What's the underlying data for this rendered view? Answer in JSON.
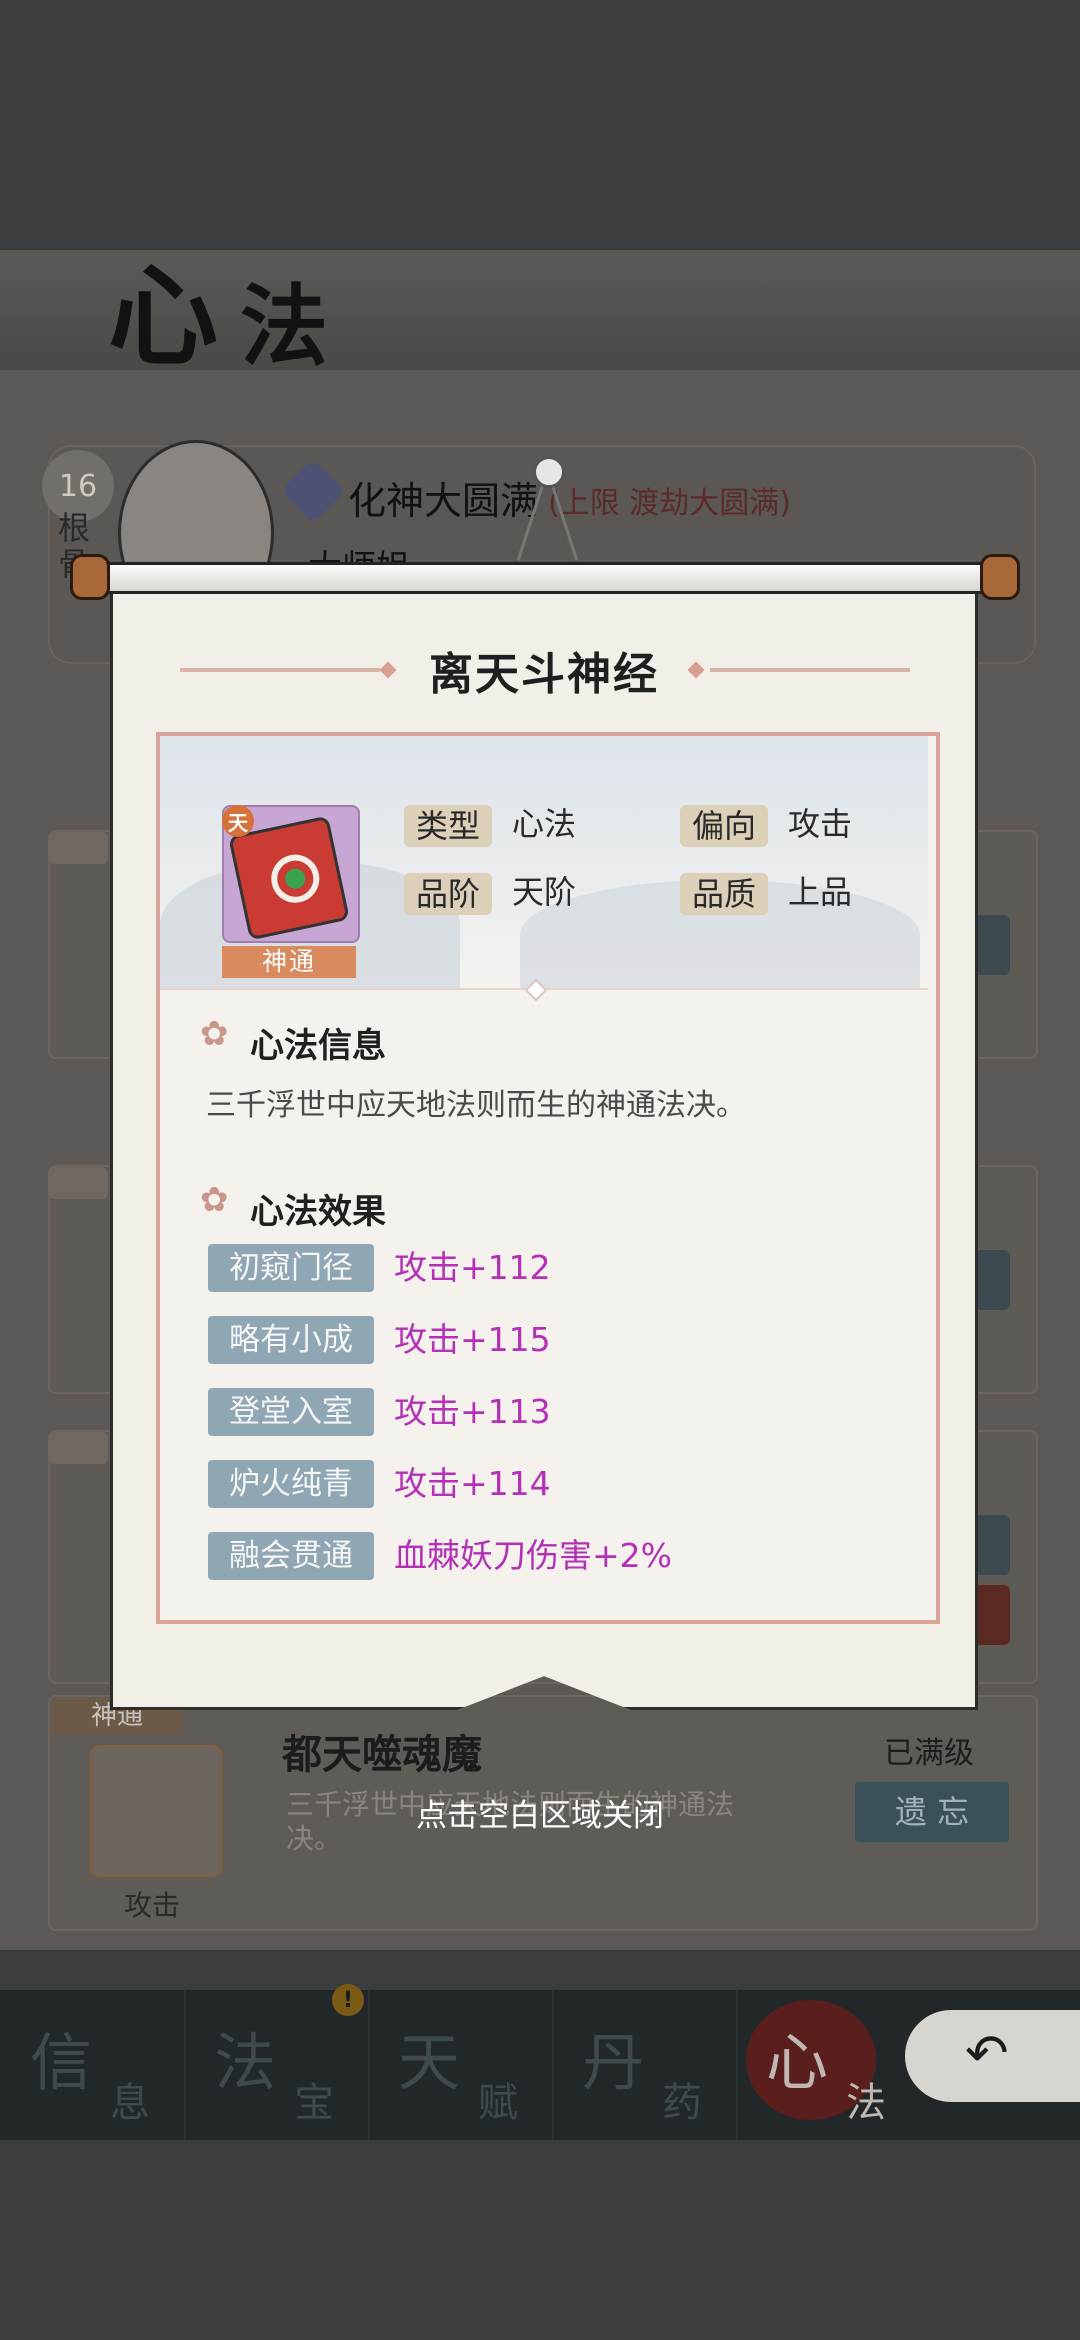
{
  "page": {
    "title_chars": [
      "心",
      "法"
    ]
  },
  "character": {
    "level": "16",
    "root_label": "根骨",
    "realm": "化神大圆满",
    "realm_limit": "(上限 渡劫大圆满)",
    "name": "大师姐"
  },
  "background_card": {
    "tag": "神通",
    "name": "都天噬魂魔",
    "desc": "三千浮世中应天地法则而生的神通法决。",
    "icon_label": "攻击",
    "status": "已满级",
    "action": "遗 忘"
  },
  "bottom_nav": {
    "items": [
      {
        "big": "信",
        "small": "息"
      },
      {
        "big": "法",
        "small": "宝"
      },
      {
        "big": "天",
        "small": "赋"
      },
      {
        "big": "丹",
        "small": "药"
      },
      {
        "big": "心",
        "small": "法"
      }
    ],
    "badge": "!",
    "active_index": 4
  },
  "popup": {
    "title": "离天斗神经",
    "book_badge": "天",
    "book_tag": "神通",
    "attributes": [
      {
        "key": "类型",
        "value": "心法"
      },
      {
        "key": "偏向",
        "value": "攻击"
      },
      {
        "key": "品阶",
        "value": "天阶"
      },
      {
        "key": "品质",
        "value": "上品"
      }
    ],
    "info_section": {
      "title": "心法信息",
      "text": "三千浮世中应天地法则而生的神通法决。"
    },
    "effect_section": {
      "title": "心法效果",
      "stages": [
        {
          "name": "初窥门径",
          "effect": "攻击+112"
        },
        {
          "name": "略有小成",
          "effect": "攻击+115"
        },
        {
          "name": "登堂入室",
          "effect": "攻击+113"
        },
        {
          "name": "炉火纯青",
          "effect": "攻击+114"
        },
        {
          "name": "融会贯通",
          "effect": "血棘妖刀伤害+2%"
        }
      ]
    }
  },
  "close_hint": "点击空白区域关闭",
  "colors": {
    "effect_text": "#b330b7",
    "stage_tag_bg": "#8fa6b4",
    "frame_border": "#d9a399",
    "book_tag_bg": "#d98a5e"
  }
}
